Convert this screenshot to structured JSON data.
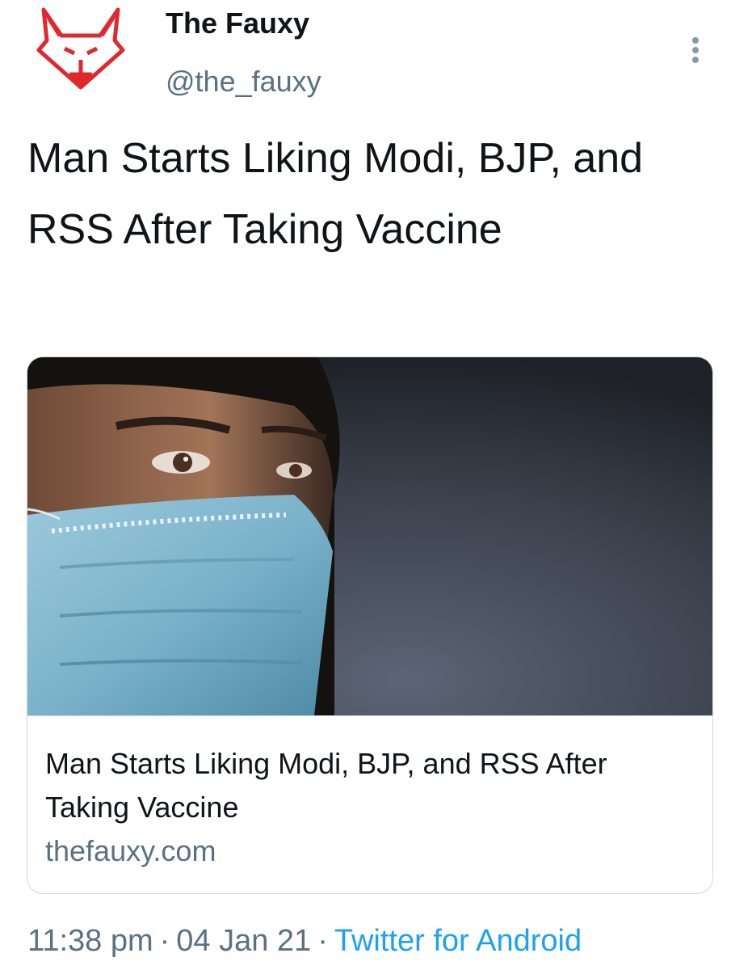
{
  "tweet": {
    "author": {
      "name": "The Fauxy",
      "handle": "@the_fauxy",
      "avatar_icon": "fox-logo-icon",
      "brand_color": "#e0282e"
    },
    "text": "Man Starts Liking Modi, BJP, and RSS After Taking Vaccine",
    "card": {
      "image_icon": "man-in-surgical-mask-photo",
      "title": "Man Starts Liking Modi, BJP, and RSS After Taking Vaccine",
      "domain": "thefauxy.com"
    },
    "meta": {
      "time": "11:38 pm",
      "separator": "·",
      "date": "04 Jan 21",
      "source": "Twitter for Android",
      "source_color": "#1da1f2"
    },
    "more_icon": "more-vertical-icon"
  }
}
